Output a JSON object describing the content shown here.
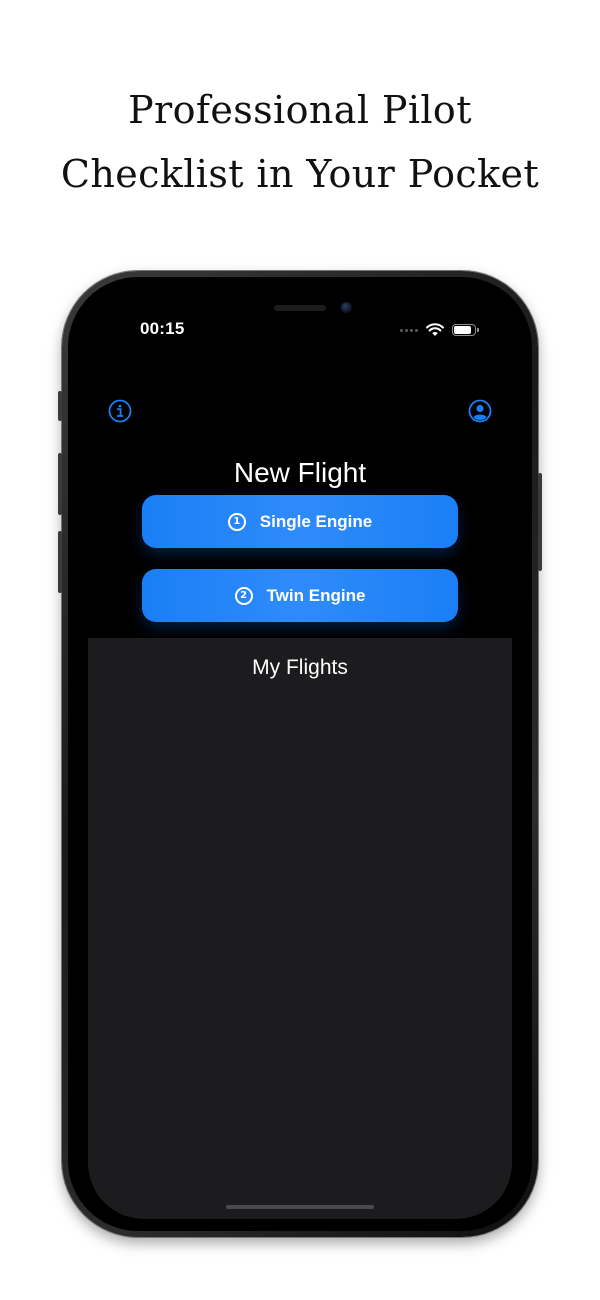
{
  "headline": {
    "line1": "Professional Pilot",
    "line2": "Checklist in Your Pocket"
  },
  "status_bar": {
    "time": "00:15",
    "icons": [
      "signal-dots-icon",
      "wifi-icon",
      "battery-icon"
    ],
    "battery_level": 0.9
  },
  "nav": {
    "left_icon": "info-icon",
    "right_icon": "profile-icon"
  },
  "new_flight": {
    "title": "New Flight",
    "buttons": [
      {
        "number": "1",
        "label": "Single Engine"
      },
      {
        "number": "2",
        "label": "Twin Engine"
      }
    ]
  },
  "my_flights": {
    "title": "My Flights"
  },
  "colors": {
    "accent": "#1a7ff5",
    "screen_bg": "#000000",
    "panel_bg": "#1c1c1e",
    "text": "#ffffff"
  }
}
